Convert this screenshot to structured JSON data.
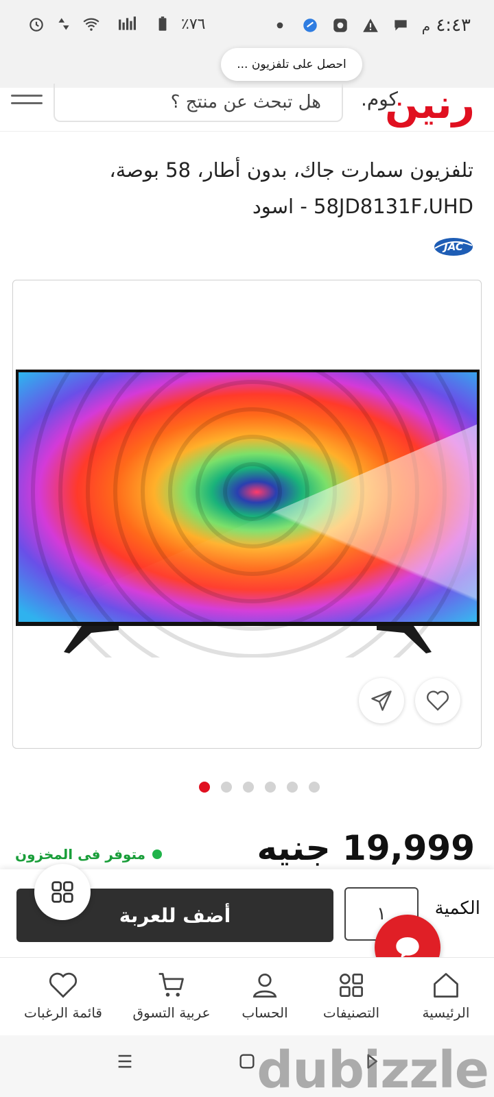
{
  "status_bar": {
    "time": "٤:٤٣",
    "ampm": "م",
    "battery": "٪٧٦",
    "toast": "احصل على تلفزيون ..."
  },
  "header": {
    "logo_text": "رنين",
    "logo_suffix": ".كوم",
    "search_placeholder": "هل تبحث عن منتج ؟"
  },
  "product": {
    "title_line1": "تلفزيون سمارت جاك، بدون أطار، 58 بوصة،",
    "title_line2": "58JD8131F،UHD - اسود",
    "brand": "JAC",
    "gallery_count": 6,
    "gallery_active_index": 0,
    "price": "19,999 جنيه",
    "stock_status": "متوفر فى المخزون"
  },
  "actions": {
    "quantity_label": "الكمية",
    "quantity_value": "١",
    "add_to_cart": "أضف للعربة"
  },
  "bottom_nav": {
    "items": [
      {
        "label": "الرئيسية",
        "icon": "home-icon"
      },
      {
        "label": "التصنيفات",
        "icon": "categories-icon"
      },
      {
        "label": "الحساب",
        "icon": "account-icon"
      },
      {
        "label": "عربية التسوق",
        "icon": "cart-icon"
      },
      {
        "label": "قائمة الرغبات",
        "icon": "wishlist-icon"
      }
    ]
  },
  "watermark": "dubizzle",
  "colors": {
    "brand_red": "#e01020",
    "stock_green": "#1a9e3a",
    "cart_button": "#2f2f2f"
  }
}
